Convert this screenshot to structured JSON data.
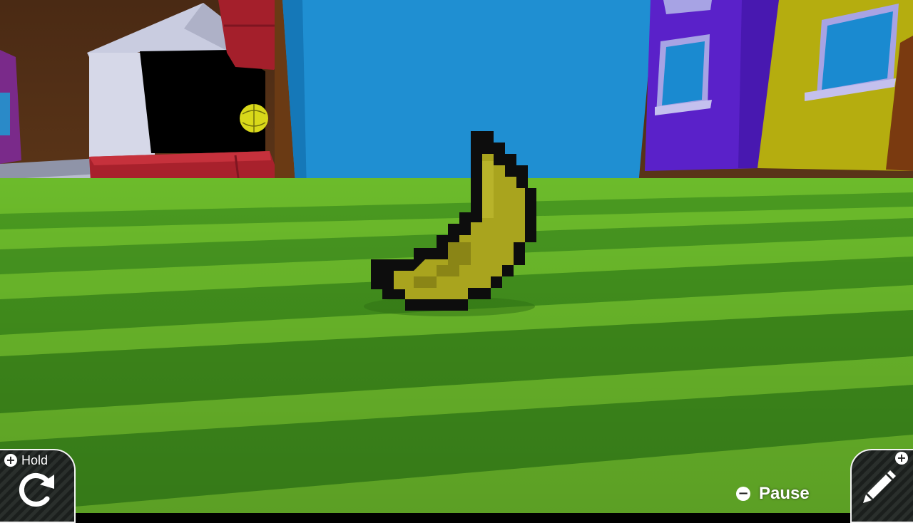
{
  "hud": {
    "hold": {
      "button_glyph": "+",
      "label": "Hold",
      "icon": "rotate-icon"
    },
    "pause": {
      "button_glyph": "−",
      "label": "Pause"
    },
    "edit": {
      "button_glyph": "+",
      "icon": "pencil-icon"
    }
  },
  "scene": {
    "object": "banana",
    "colors": {
      "grass_light": "#6fbf2c",
      "grass_dark": "#3f8f1c",
      "blue_block": "#1e90d0",
      "purple_building": "#5a22c8",
      "yellow_building": "#b7b00f",
      "banana_yellow": "#a8a51f",
      "banana_outline": "#0d0d0d",
      "red_block": "#a8202a"
    }
  }
}
